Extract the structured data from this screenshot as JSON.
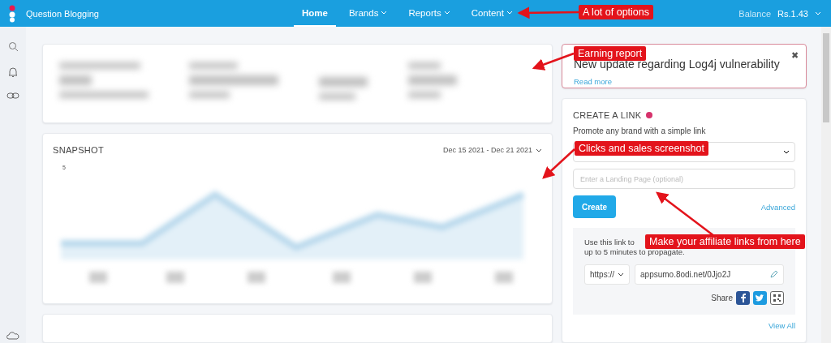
{
  "topbar": {
    "brand": "Question Blogging",
    "nav": [
      {
        "label": "Home",
        "selected": true,
        "has_menu": false
      },
      {
        "label": "Brands",
        "selected": false,
        "has_menu": true
      },
      {
        "label": "Reports",
        "selected": false,
        "has_menu": true
      },
      {
        "label": "Content",
        "selected": false,
        "has_menu": true
      }
    ],
    "balance_label": "Balance",
    "balance": "Rs.1.43"
  },
  "snapshot": {
    "title": "SNAPSHOT",
    "date_range": "Dec 15 2021 - Dec 21 2021",
    "y_tick": "5"
  },
  "notice": {
    "title": "New update regarding Log4j vulnerability",
    "link": "Read more",
    "close": "✖"
  },
  "create_link": {
    "title": "CREATE A LINK",
    "subtitle": "Promote any brand with a simple link",
    "landing_placeholder": "Enter a Landing Page (optional)",
    "create_button": "Create",
    "advanced": "Advanced",
    "help_line_1": "Use this link to",
    "help_line_2": "up to 5 minutes to propagate.",
    "protocol": "https://",
    "short_link": "appsumo.8odi.net/0Jjo2J",
    "share_label": "Share",
    "view_all": "View All"
  },
  "annotations": [
    {
      "text": "A lot of options"
    },
    {
      "text": "Earning report"
    },
    {
      "text": "Clicks and sales screenshot"
    },
    {
      "text": "Make your affiliate links from here"
    }
  ]
}
